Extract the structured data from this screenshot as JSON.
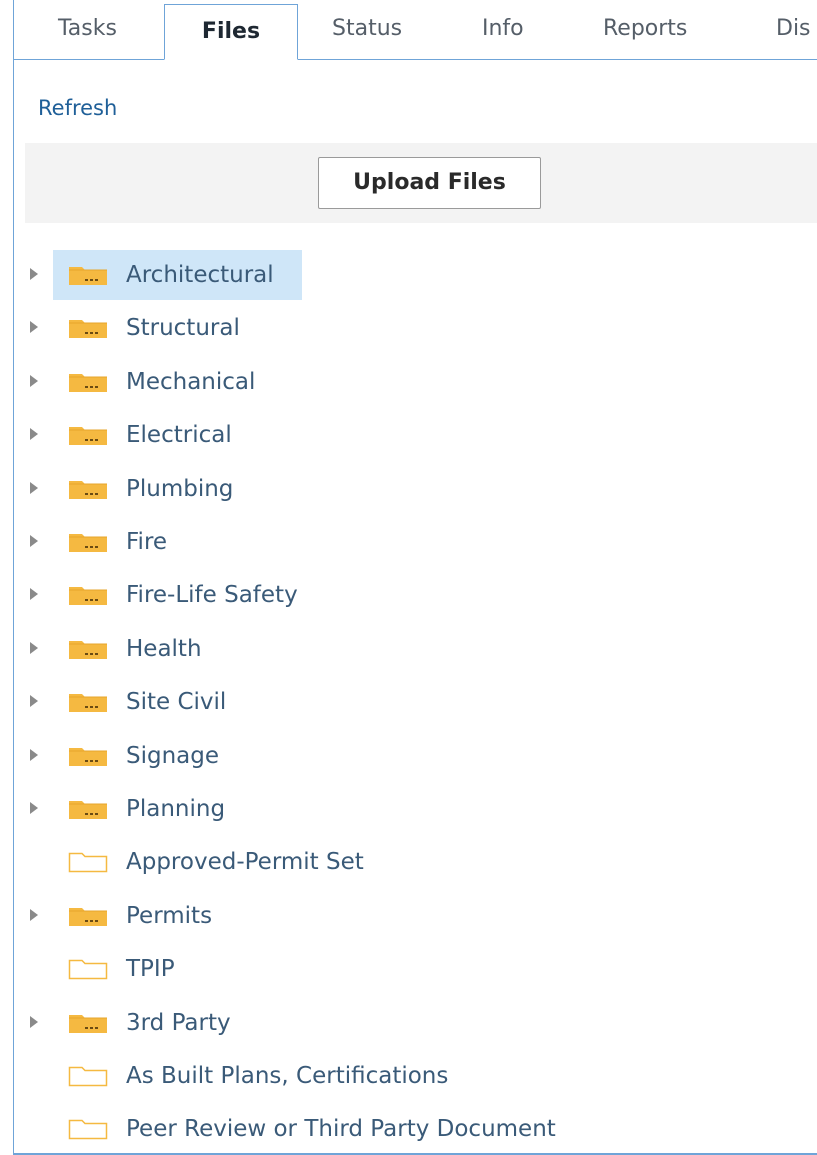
{
  "tabs": [
    {
      "label": "Tasks",
      "active": false
    },
    {
      "label": "Files",
      "active": true
    },
    {
      "label": "Status",
      "active": false
    },
    {
      "label": "Info",
      "active": false
    },
    {
      "label": "Reports",
      "active": false
    },
    {
      "label": "Dis",
      "active": false
    }
  ],
  "toolbar": {
    "refresh_label": "Refresh",
    "upload_label": "Upload Files"
  },
  "tree": [
    {
      "label": "Architectural",
      "has_children": true,
      "icon": "folder-filled-icon",
      "selected": true
    },
    {
      "label": "Structural",
      "has_children": true,
      "icon": "folder-filled-icon"
    },
    {
      "label": "Mechanical",
      "has_children": true,
      "icon": "folder-filled-icon"
    },
    {
      "label": "Electrical",
      "has_children": true,
      "icon": "folder-filled-icon"
    },
    {
      "label": "Plumbing",
      "has_children": true,
      "icon": "folder-filled-icon"
    },
    {
      "label": "Fire",
      "has_children": true,
      "icon": "folder-filled-icon"
    },
    {
      "label": "Fire-Life Safety",
      "has_children": true,
      "icon": "folder-filled-icon"
    },
    {
      "label": "Health",
      "has_children": true,
      "icon": "folder-filled-icon"
    },
    {
      "label": "Site Civil",
      "has_children": true,
      "icon": "folder-filled-icon"
    },
    {
      "label": "Signage",
      "has_children": true,
      "icon": "folder-filled-icon"
    },
    {
      "label": "Planning",
      "has_children": true,
      "icon": "folder-filled-icon"
    },
    {
      "label": "Approved-Permit Set",
      "has_children": false,
      "icon": "folder-outline-icon"
    },
    {
      "label": "Permits",
      "has_children": true,
      "icon": "folder-filled-icon"
    },
    {
      "label": "TPIP",
      "has_children": false,
      "icon": "folder-outline-icon"
    },
    {
      "label": "3rd Party",
      "has_children": true,
      "icon": "folder-filled-icon"
    },
    {
      "label": "As Built Plans, Certifications",
      "has_children": false,
      "icon": "folder-outline-icon"
    },
    {
      "label": "Peer Review or Third Party Document",
      "has_children": false,
      "icon": "folder-outline-icon"
    }
  ],
  "colors": {
    "accent_border": "#6fa4d8",
    "folder_fill": "#f5b941",
    "selected_bg": "#cfe6f8",
    "link": "#1f5f98"
  }
}
